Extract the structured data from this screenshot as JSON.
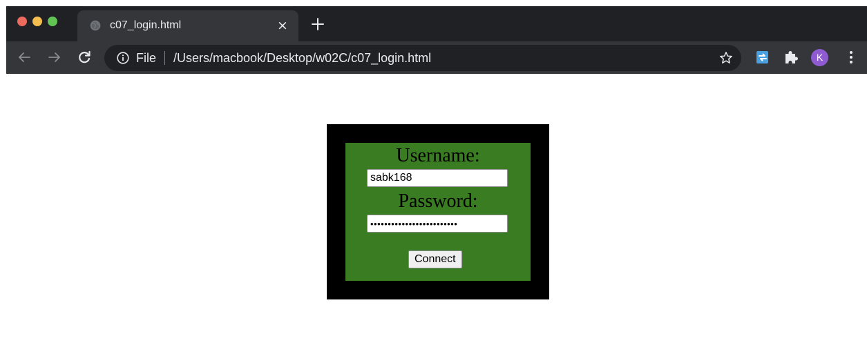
{
  "tab": {
    "title": "c07_login.html",
    "close_glyph": "×",
    "favicon": "globe-icon"
  },
  "toolbar": {
    "scheme_label": "File",
    "url": "/Users/macbook/Desktop/w02C/c07_login.html",
    "profile_initial": "K"
  },
  "icons": {
    "back": "arrow-left-icon",
    "forward": "arrow-right-icon",
    "reload": "reload-icon",
    "info": "info-icon",
    "bookmark": "star-icon",
    "extension_1": "extension-icon",
    "extensions": "puzzle-icon",
    "menu": "kebab-menu-icon"
  },
  "form": {
    "username_label": "Username:",
    "username_value": "sabk168",
    "password_label": "Password:",
    "password_value": "•••••••••••••••••••••••••",
    "submit_label": "Connect"
  },
  "colors": {
    "frame_border": "#000000",
    "panel_background": "#3a7c22",
    "browser_dark": "#202124",
    "toolbar": "#35363a",
    "avatar": "#8e5bd0"
  }
}
